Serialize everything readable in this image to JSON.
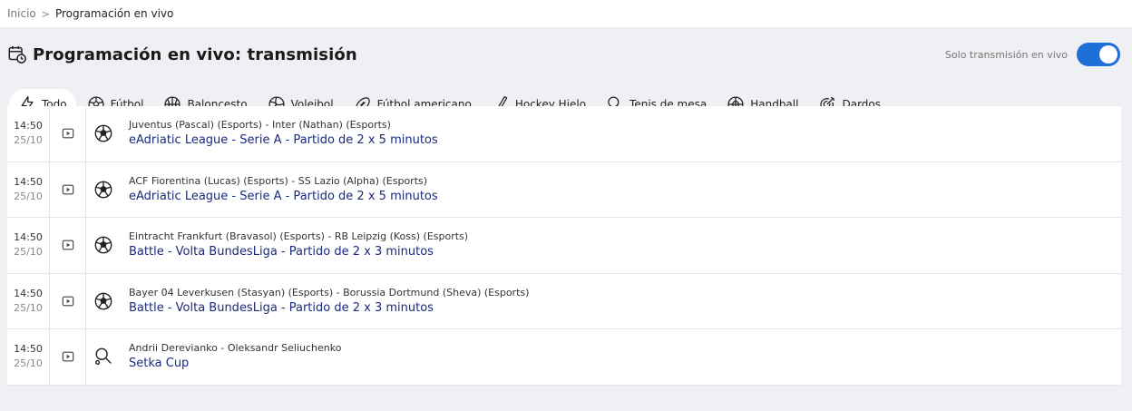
{
  "breadcrumb": {
    "home": "Inicio",
    "separator": ">",
    "current": "Programación en vivo"
  },
  "header": {
    "title": "Programación en vivo: transmisión",
    "icon": "calendar-clock-icon"
  },
  "toggle": {
    "label": "Solo transmisión en vivo",
    "on": true
  },
  "sports": [
    {
      "label": "Todo",
      "icon": "lightning-icon",
      "active": true
    },
    {
      "label": "Fútbol",
      "icon": "soccer-ball-icon"
    },
    {
      "label": "Baloncesto",
      "icon": "basketball-icon"
    },
    {
      "label": "Voleibol",
      "icon": "volleyball-icon"
    },
    {
      "label": "Fútbol americano",
      "icon": "american-football-icon"
    },
    {
      "label": "Hockey Hielo",
      "icon": "hockey-stick-icon"
    },
    {
      "label": "Tenis de mesa",
      "icon": "table-tennis-icon"
    },
    {
      "label": "Handball",
      "icon": "handball-icon"
    },
    {
      "label": "Dardos",
      "icon": "darts-icon"
    }
  ],
  "events": [
    {
      "time": "14:50",
      "date": "25/10",
      "sport_icon": "soccer-ball-icon",
      "teams": "Juventus (Pascal) (Esports) - Inter (Nathan) (Esports)",
      "league": "eAdriatic League - Serie A - Partido de 2 x 5 minutos"
    },
    {
      "time": "14:50",
      "date": "25/10",
      "sport_icon": "soccer-ball-icon",
      "teams": "ACF Fiorentina (Lucas) (Esports) - SS Lazio (Alpha) (Esports)",
      "league": "eAdriatic League - Serie A - Partido de 2 x 5 minutos"
    },
    {
      "time": "14:50",
      "date": "25/10",
      "sport_icon": "soccer-ball-icon",
      "teams": "Eintracht Frankfurt (Bravasol) (Esports) - RB Leipzig (Koss) (Esports)",
      "league": "Battle - Volta BundesLiga - Partido de 2 x 3 minutos"
    },
    {
      "time": "14:50",
      "date": "25/10",
      "sport_icon": "soccer-ball-icon",
      "teams": "Bayer 04 Leverkusen (Stasyan) (Esports) - Borussia Dortmund (Sheva) (Esports)",
      "league": "Battle - Volta BundesLiga - Partido de 2 x 3 minutos"
    },
    {
      "time": "14:50",
      "date": "25/10",
      "sport_icon": "table-tennis-icon",
      "teams": "Andrii Derevianko - Oleksandr Seliuchenko",
      "league": "Setka Cup"
    }
  ],
  "colors": {
    "accent": "#1e6fd9",
    "league_link": "#1a2a7c",
    "panel_bg": "#eef0f3",
    "top_line": "#e8642c"
  }
}
